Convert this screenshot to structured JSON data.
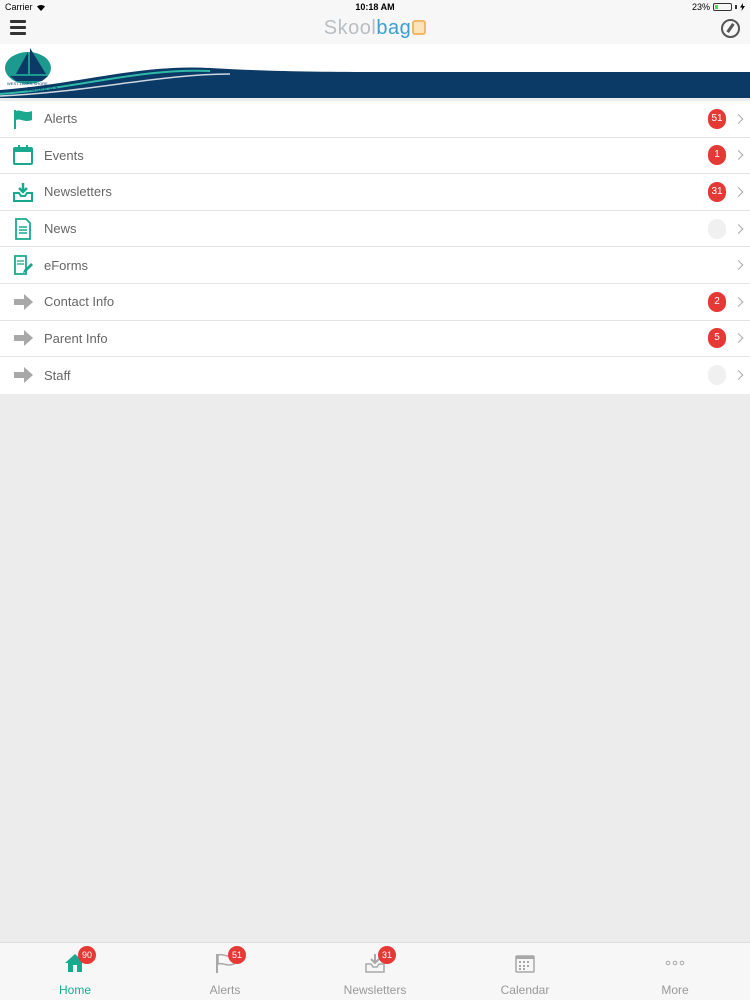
{
  "status_bar": {
    "carrier": "Carrier",
    "time": "10:18 AM",
    "battery": "23%",
    "battery_level": 0.23
  },
  "header": {
    "brand_part1": "Skool",
    "brand_part2": "bag"
  },
  "banner": {
    "school_line1": "WEST LAKES SHORE",
    "school_line2": "SCHOOL R-7"
  },
  "menu": [
    {
      "label": "Alerts",
      "badge": "51",
      "icon": "flag-icon"
    },
    {
      "label": "Events",
      "badge": "1",
      "icon": "calendar-icon"
    },
    {
      "label": "Newsletters",
      "badge": "31",
      "icon": "inbox-download-icon"
    },
    {
      "label": "News",
      "badge": "",
      "icon": "document-icon"
    },
    {
      "label": "eForms",
      "badge": null,
      "icon": "form-edit-icon"
    },
    {
      "label": "Contact Info",
      "badge": "2",
      "icon": "arrow-right-icon"
    },
    {
      "label": "Parent Info",
      "badge": "5",
      "icon": "arrow-right-icon"
    },
    {
      "label": "Staff",
      "badge": "",
      "icon": "arrow-right-icon"
    }
  ],
  "tabs": [
    {
      "label": "Home",
      "badge": "90",
      "icon": "home-icon",
      "active": true
    },
    {
      "label": "Alerts",
      "badge": "51",
      "icon": "flag-icon",
      "active": false
    },
    {
      "label": "Newsletters",
      "badge": "31",
      "icon": "inbox-download-icon",
      "active": false
    },
    {
      "label": "Calendar",
      "badge": null,
      "icon": "calendar-icon",
      "active": false
    },
    {
      "label": "More",
      "badge": null,
      "icon": "more-dots-icon",
      "active": false
    }
  ],
  "colors": {
    "accent": "#19a98f",
    "badge": "#e53935",
    "navy": "#0b3a66",
    "gray_icon": "#a8a8a8"
  }
}
